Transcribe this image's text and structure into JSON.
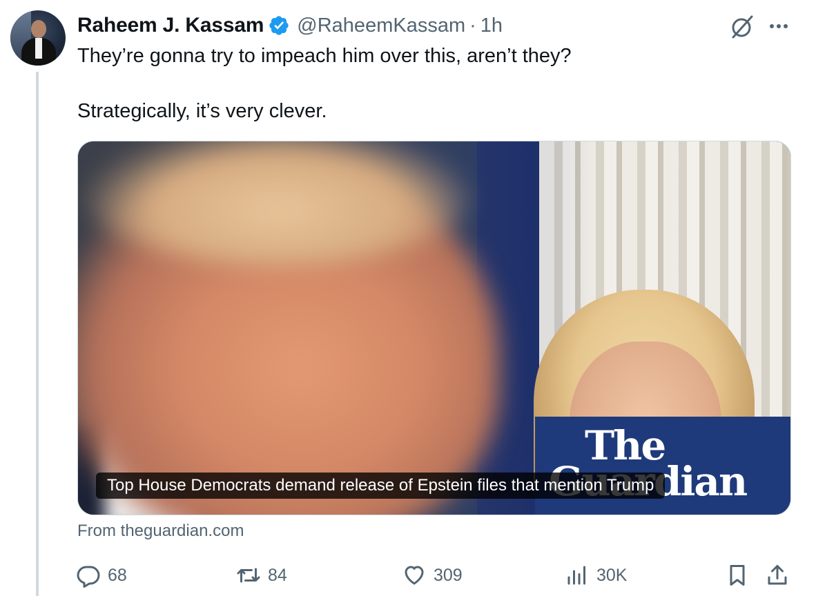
{
  "author": {
    "name": "Raheem J. Kassam",
    "handle": "@RaheemKassam",
    "separator": "·",
    "time": "1h",
    "verified_color": "#1d9bf0"
  },
  "tweet": {
    "line1": "They’re gonna try to impeach him over this, aren’t they?",
    "line2": "Strategically, it’s very clever."
  },
  "card": {
    "caption": "Top House Democrats demand release of Epstein files that mention Trump",
    "logo_the": "The",
    "logo_guardian": "Guardian",
    "source": "From theguardian.com"
  },
  "actions": {
    "replies": "68",
    "reposts": "84",
    "likes": "309",
    "views": "30K"
  },
  "icons": {
    "verified": "verified-badge-icon",
    "grok": "grok-icon",
    "more": "more-icon",
    "reply": "reply-icon",
    "repost": "repost-icon",
    "like": "heart-icon",
    "views": "views-icon",
    "bookmark": "bookmark-icon",
    "share": "share-icon"
  },
  "colors": {
    "text": "#0f1419",
    "muted": "#536471",
    "accent": "#1d9bf0",
    "guardian_navy": "#1f3a7a"
  }
}
